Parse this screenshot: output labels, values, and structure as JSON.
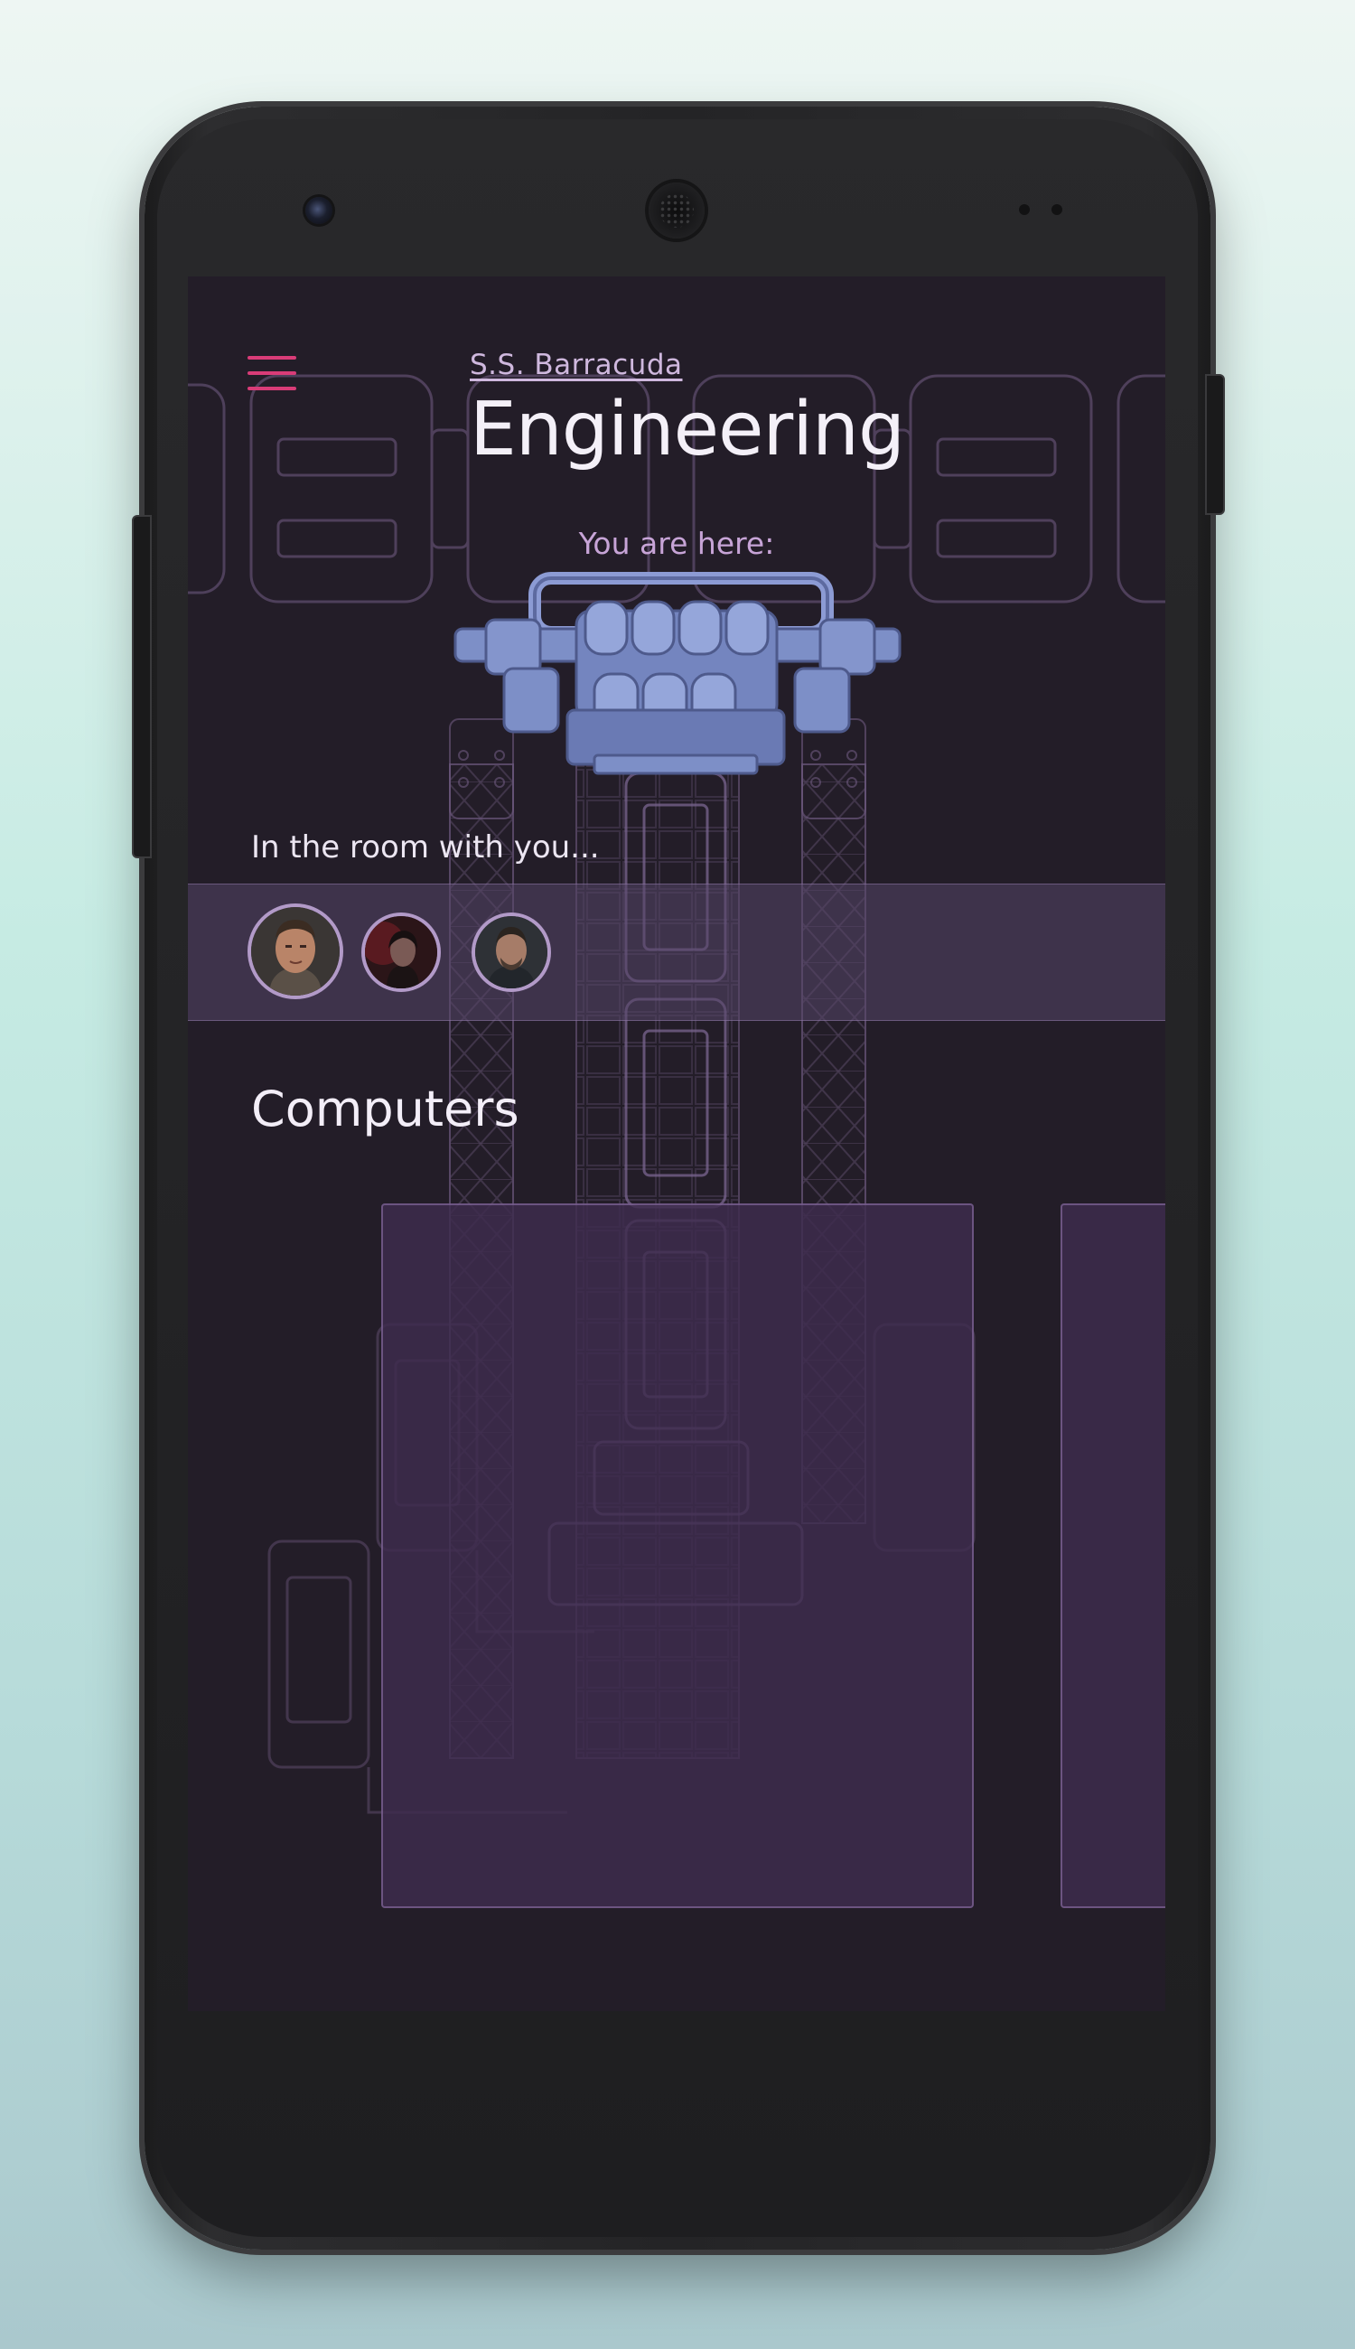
{
  "header": {
    "ship_name": "S.S. Barracuda",
    "title": "Engineering"
  },
  "location": {
    "label": "You are here:"
  },
  "crew": {
    "label": "In the room with you...",
    "members": [
      {
        "icon": "crew-avatar-1"
      },
      {
        "icon": "crew-avatar-2"
      },
      {
        "icon": "crew-avatar-3"
      }
    ]
  },
  "computers": {
    "heading": "Computers",
    "cards": [
      {
        "icon": "computer-card"
      },
      {
        "icon": "computer-card"
      }
    ]
  },
  "colors": {
    "accent_menu": "#d93c78",
    "screen_bg": "#231d28",
    "highlight_blue": "#7d8fc7",
    "card_bg": "#3e2c4e"
  }
}
